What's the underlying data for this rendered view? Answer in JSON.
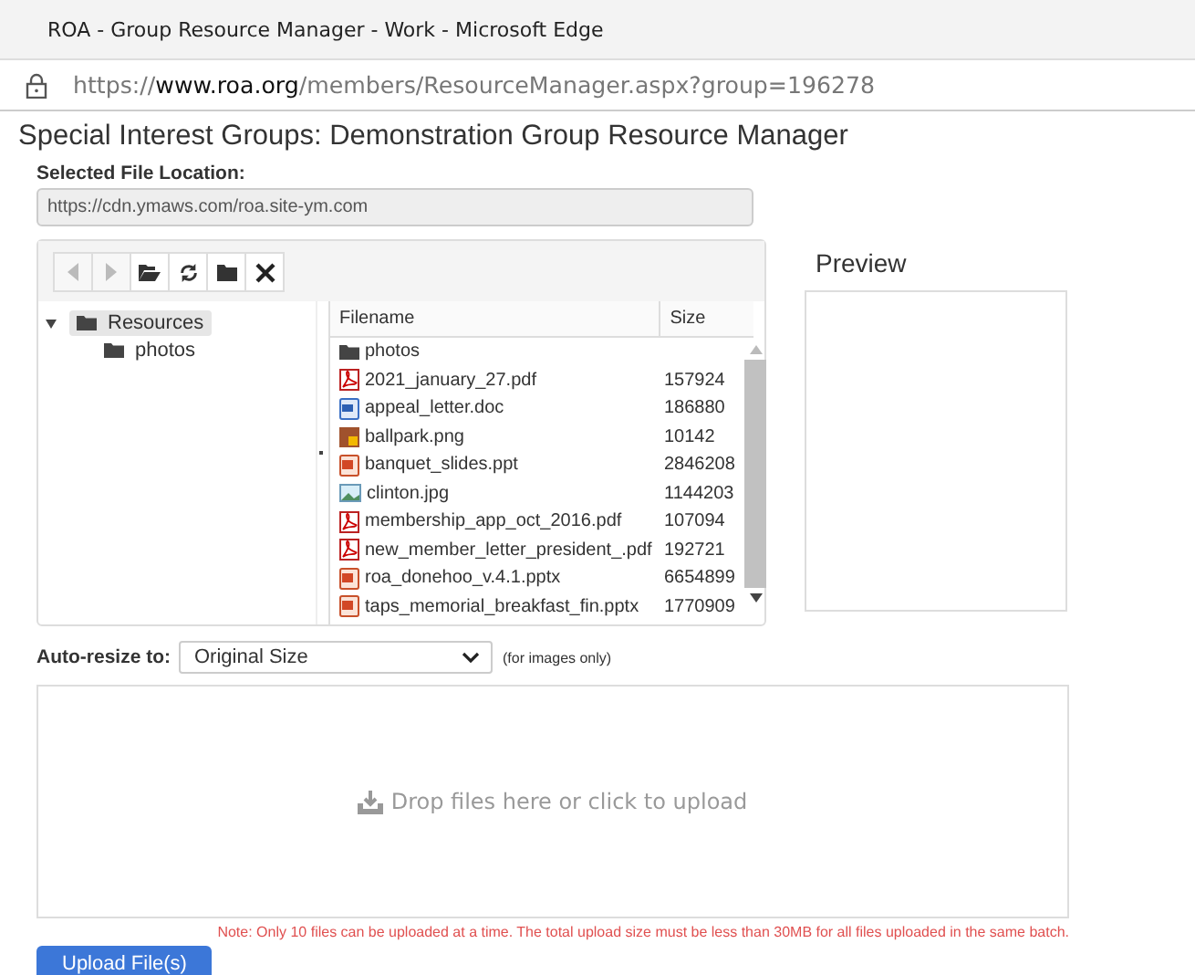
{
  "window": {
    "title": "ROA - Group Resource Manager - Work - Microsoft Edge"
  },
  "address_bar": {
    "url": "https://**www.roa.org**/members/ResourceManager.aspx?group=196278"
  },
  "page_title": "Special Interest Groups: Demonstration Group Resource Manager",
  "file_location": {
    "label": "Selected File Location:",
    "value": "https://cdn.ymaws.com/roa.site-ym.com"
  },
  "toolbar": [
    {
      "kind": "back",
      "disabled": true
    },
    {
      "kind": "forward",
      "disabled": true
    },
    {
      "kind": "open",
      "disabled": false
    },
    {
      "kind": "refresh",
      "disabled": false
    },
    {
      "kind": "folder",
      "disabled": false
    },
    {
      "kind": "delete",
      "disabled": false
    }
  ],
  "tree": [
    {
      "label": "Resources",
      "selected": true,
      "expanded": true,
      "children": [
        {
          "label": "photos",
          "selected": false
        }
      ]
    }
  ],
  "grid": {
    "columns": [
      "Filename",
      "Size"
    ],
    "rows": [
      {
        "kind": "folder",
        "name": "photos"
      },
      {
        "kind": "pdf",
        "name": "2021_january_27.pdf",
        "size": "157924"
      },
      {
        "kind": "doc",
        "name": "appeal_letter.doc",
        "size": "186880"
      },
      {
        "kind": "png",
        "name": "ballpark.png",
        "size": "10142"
      },
      {
        "kind": "ppt",
        "name": "banquet_slides.ppt",
        "size": "2846208"
      },
      {
        "kind": "jpg",
        "name": "clinton.jpg",
        "size": "1144203"
      },
      {
        "kind": "pdf",
        "name": "membership_app_oct_2016.pdf",
        "size": "107094"
      },
      {
        "kind": "pdf",
        "name": "new_member_letter_president_.pdf",
        "size": "192721"
      },
      {
        "kind": "ppt",
        "name": "roa_donehoo_v.4.1.pptx",
        "size": "6654899"
      },
      {
        "kind": "ppt",
        "name": "taps_memorial_breakfast_fin.pptx",
        "size": "1770909"
      }
    ]
  },
  "preview": {
    "title": "Preview"
  },
  "auto_resize": {
    "label": "Auto-resize to:",
    "value": "Original Size",
    "hint": "(for images only)"
  },
  "dropzone": {
    "text": "Drop files here or click to upload"
  },
  "note": "Note: Only 10 files can be uploaded at a time. The total upload size must be less than 30MB for all files uploaded in the same batch.",
  "upload_button": "Upload File(s)"
}
